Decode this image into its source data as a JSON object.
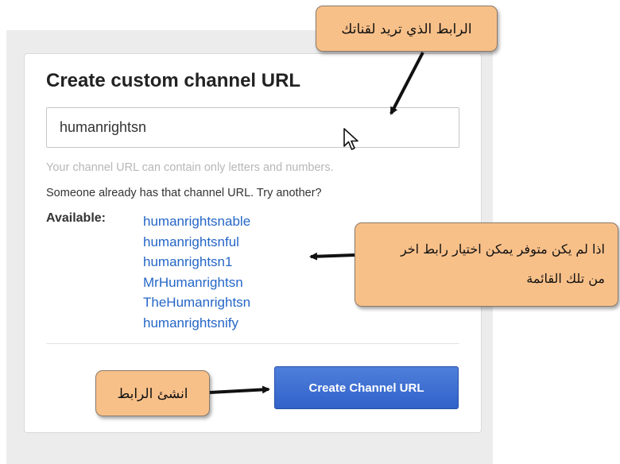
{
  "form": {
    "title": "Create custom channel URL",
    "input_value": "humanrightsn",
    "hint": "Your channel URL can contain only letters and numbers.",
    "taken_message": "Someone already has that channel URL. Try another?",
    "available_label": "Available:",
    "suggestions": [
      "humanrightsnable",
      "humanrightsnful",
      "humanrightsn1",
      "MrHumanrightsn",
      "TheHumanrightsn",
      "humanrightsnify"
    ],
    "create_button_label": "Create Channel URL"
  },
  "annotations": {
    "top_callout": "الرابط الذي تريد لقناتك",
    "middle_callout_line1": "اذا لم يكن متوفر يمكن اختيار رابط اخر",
    "middle_callout_line2": "من تلك القائمة",
    "bottom_callout": "انشئ الرابط"
  },
  "colors": {
    "link": "#2566c7",
    "button": "#3062c9",
    "callout_fill": "#f8c089"
  }
}
